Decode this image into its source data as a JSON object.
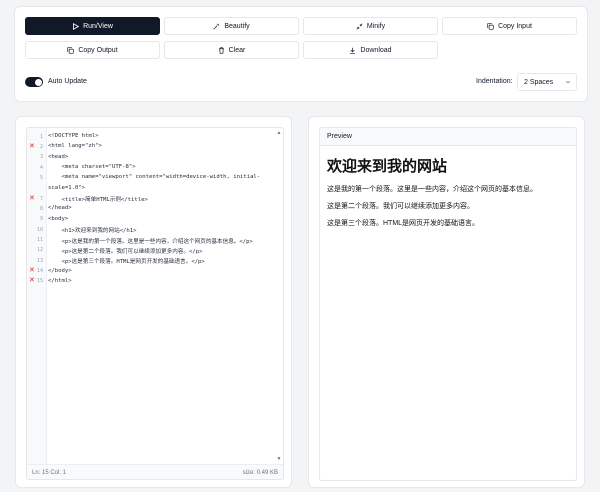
{
  "toolbar": {
    "run_view": "Run/View",
    "beautify": "Beautify",
    "minify": "Minify",
    "copy_input": "Copy Input",
    "copy_output": "Copy Output",
    "clear": "Clear",
    "download": "Download"
  },
  "options": {
    "auto_update_label": "Auto Update",
    "auto_update_on": true,
    "indentation_label": "Indentation:",
    "indentation_value": "2 Spaces"
  },
  "editor": {
    "lines": [
      {
        "n": "1",
        "text": "<!DOCTYPE html>",
        "err": false
      },
      {
        "n": "2",
        "text": "<html lang=\"zh\">",
        "err": true
      },
      {
        "n": "3",
        "text": "<head>",
        "err": false
      },
      {
        "n": "4",
        "text": "    <meta charset=\"UTF-8\">",
        "err": false
      },
      {
        "n": "5",
        "text": "    <meta name=\"viewport\" content=\"width=device-width, initial-",
        "err": false
      },
      {
        "n": "",
        "text": "scale=1.0\">",
        "err": false
      },
      {
        "n": "7",
        "text": "    <title>简单HTML示例</title>",
        "err": true
      },
      {
        "n": "8",
        "text": "</head>",
        "err": false
      },
      {
        "n": "9",
        "text": "<body>",
        "err": false
      },
      {
        "n": "10",
        "text": "    <h1>欢迎来到我的网站</h1>",
        "err": false
      },
      {
        "n": "11",
        "text": "    <p>这是我的第一个段落。这里是一些内容，介绍这个网页的基本信息。</p>",
        "err": false
      },
      {
        "n": "12",
        "text": "    <p>这是第二个段落。我们可以继续添加更多内容。</p>",
        "err": false
      },
      {
        "n": "13",
        "text": "    <p>这是第三个段落。HTML是网页开发的基础语言。</p>",
        "err": false
      },
      {
        "n": "14",
        "text": "</body>",
        "err": true
      },
      {
        "n": "15",
        "text": "</html>",
        "err": true
      }
    ],
    "status_position": "Ln: 15 Col: 1",
    "status_size": "size: 0.49 KB"
  },
  "preview": {
    "header": "Preview",
    "heading": "欢迎来到我的网站",
    "paragraphs": [
      "这是我的第一个段落。这里是一些内容，介绍这个网页的基本信息。",
      "这是第二个段落。我们可以继续添加更多内容。",
      "这是第三个段落。HTML是网页开发的基础语言。"
    ]
  },
  "colors": {
    "primary": "#111827",
    "error": "#dc2626",
    "border": "#e5e7eb"
  }
}
